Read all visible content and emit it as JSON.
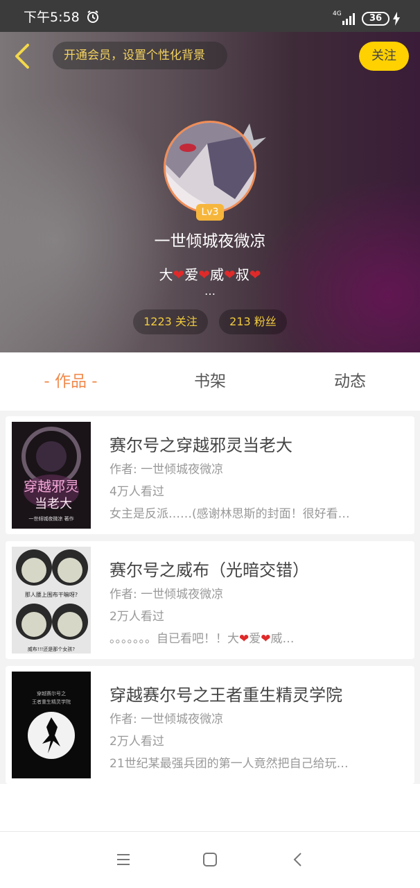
{
  "status_bar": {
    "time": "下午5:58",
    "network": "4G",
    "battery": "36"
  },
  "header": {
    "vip_prompt": "开通会员，设置个性化背景",
    "follow_label": "关注",
    "level": "Lv3",
    "username": "一世倾城夜微凉",
    "bio": [
      "大",
      "❤",
      "爱",
      "❤",
      "威",
      "❤",
      "叔",
      "❤"
    ],
    "bio_more": "…",
    "following": "1223 关注",
    "fans": "213 粉丝"
  },
  "tabs": [
    {
      "label": "- 作品 -",
      "active": true
    },
    {
      "label": "书架",
      "active": false
    },
    {
      "label": "动态",
      "active": false
    }
  ],
  "books": [
    {
      "title": "赛尔号之穿越邪灵当老大",
      "author": "作者: 一世倾城夜微凉",
      "reads": "4万人看过",
      "desc": "女主是反派……(感谢林思斯的封面！很好看…",
      "cover_text": [
        "穿越邪灵",
        "当老大",
        "一世倾城夜微凉 著作"
      ]
    },
    {
      "title": "赛尔号之威布（光暗交错）",
      "author": "作者: 一世倾城夜微凉",
      "reads": "2万人看过",
      "desc_parts": [
        "。。。。。。。自已看吧！！大",
        "❤",
        "爱",
        "❤",
        "威…"
      ],
      "cover_text": [
        "那人腰上围布干嘛呀?",
        "威布!!!还是那个女孩?"
      ]
    },
    {
      "title": "穿越赛尔号之王者重生精灵学院",
      "author": "作者: 一世倾城夜微凉",
      "reads": "2万人看过",
      "desc": "21世纪某最强兵团的第一人竟然把自己给玩…",
      "cover_text": [
        "穿越赛尔号之",
        "王者重生精灵学院"
      ]
    }
  ],
  "colors": {
    "accent": "#f08a4c",
    "follow_bg": "#ffd100",
    "stat_text": "#f2cc3d",
    "heart": "#e02a2a"
  },
  "icons": {
    "back": "chevron-left-icon",
    "menu": "menu-icon",
    "home": "home-icon",
    "nav_back": "back-icon"
  }
}
